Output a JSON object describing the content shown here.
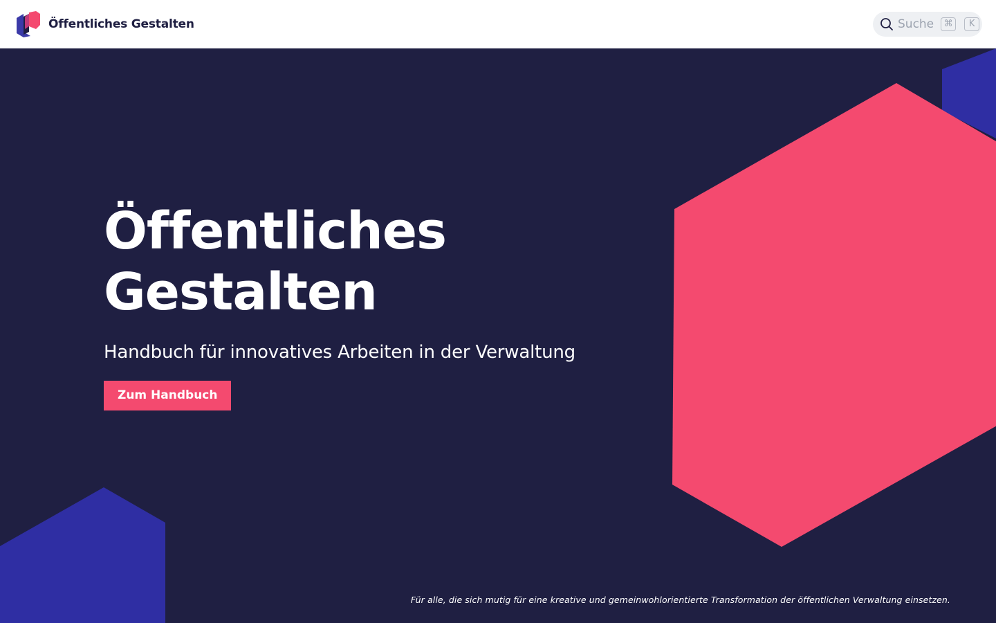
{
  "header": {
    "brand_name": "Öffentliches Gestalten",
    "search": {
      "placeholder": "Suche",
      "shortcut_keys": [
        "⌘",
        "K"
      ]
    }
  },
  "hero": {
    "title": "Öffentliches\nGestalten",
    "subtitle": "Handbuch für innovatives Arbeiten in der Verwaltung",
    "cta_label": "Zum Handbuch",
    "tagline": "Für alle, die sich mutig für eine kreative und gemeinwohlorientierte Transformation der öffentlichen Verwaltung einsetzen."
  },
  "colors": {
    "background": "#1f1f42",
    "accent": "#f44a6f",
    "hexagon_blue": "#2f2ea3",
    "header_bg": "#ffffff"
  },
  "icons": {
    "brand": "hexagon-logo-icon",
    "search": "search-icon"
  }
}
